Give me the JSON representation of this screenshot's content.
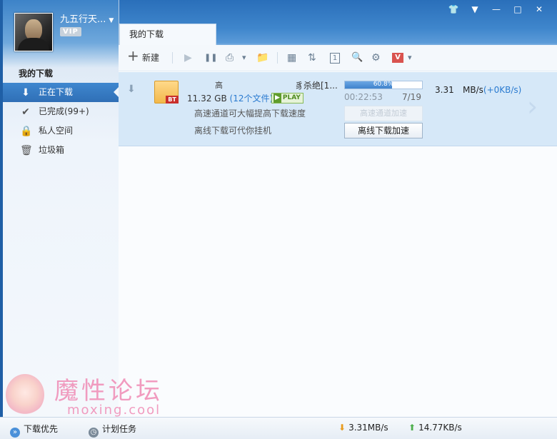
{
  "window": {
    "controls": [
      "👕",
      "▼",
      "—",
      "□",
      "✕"
    ]
  },
  "user": {
    "name": "九五行天...",
    "badge": "VIP"
  },
  "sidebar": {
    "title": "我的下载",
    "items": [
      {
        "label": "正在下载",
        "icon": "download-icon",
        "glyph": "⬇"
      },
      {
        "label": "已完成(99+)",
        "icon": "check-icon",
        "glyph": "✔"
      },
      {
        "label": "私人空间",
        "icon": "lock-icon",
        "glyph": "🔒"
      },
      {
        "label": "垃圾箱",
        "icon": "trash-icon",
        "glyph": "🗑"
      }
    ]
  },
  "tab": {
    "label": "我的下载"
  },
  "toolbar": {
    "new_label": "新建",
    "new_glyph": "+",
    "icons": {
      "start": "▶",
      "pause": "❚❚",
      "plan": "⎙",
      "plan_caret": "▾",
      "folder": "📁",
      "grid": "▦",
      "sort": "⇅",
      "number": "1",
      "search": "🔍",
      "settings": "⚙",
      "vip": "V",
      "vip_caret": "▾"
    }
  },
  "task": {
    "name_part1": "高",
    "name_part2": "豸杀绝[1...",
    "size": "11.32 GB",
    "files": "(12个文件)",
    "play_label": "PLAY",
    "progress_percent": 60.8,
    "progress_label": "60.8%",
    "elapsed": "00:22:53",
    "pieces": "7/19",
    "speed": "3.31",
    "speed_unit": "MB/s",
    "speed_delta": "(+0KB/s)",
    "hint_highspeed": "高速通道可大幅提高下载速度",
    "hint_offline": "离线下载可代你挂机",
    "btn_highspeed": "高速通道加速",
    "btn_offline": "离线下载加速"
  },
  "watermark": {
    "title": "魔性论坛",
    "url": "moxing.cool"
  },
  "statusbar": {
    "download_first": "下载优先",
    "scheduled": "计划任务",
    "down_speed": "3.31MB/s",
    "up_speed": "14.77KB/s"
  },
  "colors": {
    "accent": "#2f6fb6",
    "progress": "#3f82cc",
    "link": "#2b7bd0"
  }
}
